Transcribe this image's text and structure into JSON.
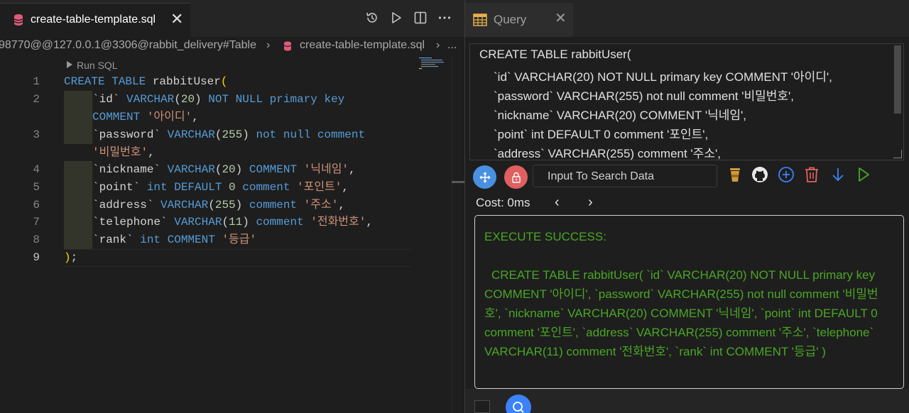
{
  "editor": {
    "tab": {
      "label": "create-table-template.sql",
      "close": "✕"
    },
    "actions": [
      "history-icon",
      "run-icon",
      "split-editor-icon",
      "more-icon"
    ],
    "breadcrumb": {
      "connection": "98770@@127.0.0.1@3306@rabbit_delivery#Table",
      "sep1": "›",
      "file": "create-table-template.sql",
      "sep2": "›",
      "more": "..."
    },
    "codelens": "Run SQL",
    "line_numbers": [
      "1",
      "2",
      "3",
      "4",
      "5",
      "6",
      "7",
      "8",
      "9"
    ],
    "current_line": "9"
  },
  "query": {
    "tab_label": "Query",
    "tab_close": "✕",
    "sql_lines": [
      "CREATE TABLE rabbitUser(",
      "`id` VARCHAR(20) NOT NULL primary key  COMMENT '아이디',",
      "`password` VARCHAR(255) not null comment '비밀번호',",
      "`nickname` VARCHAR(20) COMMENT '닉네임',",
      "`point` int DEFAULT 0 comment '포인트',",
      "`address` VARCHAR(255) comment '주소',"
    ],
    "search_placeholder": "Input To Search Data",
    "cost": "Cost: 0ms",
    "prev": "‹",
    "next": "›",
    "result_head": "EXECUTE SUCCESS:",
    "result_body": "CREATE TABLE rabbitUser( `id` VARCHAR(20) NOT NULL primary key COMMENT '아이디', `password` VARCHAR(255) not null comment '비밀번호', `nickname` VARCHAR(20) COMMENT '닉네임', `point` int DEFAULT 0 comment '포인트', `address` VARCHAR(255) comment '주소', `telephone` VARCHAR(11) comment '전화번호', `rank` int COMMENT '등급' )"
  },
  "colors": {
    "accent": "#3b82f6",
    "lock": "#e06060",
    "success": "#4aa625",
    "cup": "#d19a3c"
  }
}
